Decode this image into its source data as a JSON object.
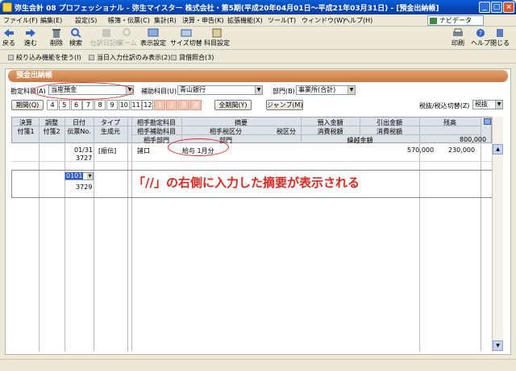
{
  "window": {
    "title": "弥生会計 08 プロフェッショナル - 弥生マイスター 株式会社・第5期(平成20年04月01日～平成21年03月31日) - [預金出納帳]",
    "minimize_label": "_",
    "maximize_label": "□",
    "close_label": "×"
  },
  "menubar": {
    "items": [
      "ファイル(F)",
      "編集(E)",
      "設定(S)",
      "帳簿・伝票(C)",
      "集計(R)",
      "決算・申告(K)",
      "拡張機能(X)",
      "ツール(T)",
      "ウィンドウ(W)",
      "ヘルプ(H)"
    ],
    "navi_label": "ナビデータ"
  },
  "toolbar": {
    "items": [
      "戻る",
      "進む",
      "削除",
      "検索",
      "仕訳日記帳",
      "ズーム",
      "表示設定",
      "サイズ切替",
      "科目設定"
    ],
    "right_items": [
      "印刷",
      "ヘルプ",
      "閉じる"
    ]
  },
  "optionbar": {
    "items": [
      "絞り込み機能を使う(I)",
      "当日入力仕訳のみ表示(2)",
      "貸借照合(3)"
    ]
  },
  "ledger": {
    "header": "預金出納帳",
    "account_label": "勘定科目(A)",
    "account_value": "当座預金",
    "sub_account_label": "補助科目(U)",
    "sub_account_value": "青山銀行",
    "dept_label": "部門(B)",
    "dept_value": "事業所(合計)",
    "period_button": "期間(Q)",
    "months": [
      "4",
      "5",
      "6",
      "7",
      "8",
      "9",
      "10",
      "11",
      "12",
      "1",
      "2",
      "3",
      "決"
    ],
    "all_period_button": "全期間(Y)",
    "jump_button": "ジャンプ(M)",
    "tax_label": "税抜/税込切替(Z)",
    "tax_value": "税抜"
  },
  "grid": {
    "headers": {
      "kessan": "決算",
      "fusen1": "付箋1",
      "chosei": "調整",
      "fusen2": "付箋2",
      "hizuke": "日付",
      "denpyo_no": "伝票No.",
      "type": "タイプ",
      "seiseimoto": "生成元",
      "aite_kamoku": "相手勘定科目",
      "aite_hojo": "相手補助科目",
      "aite_bumon": "相手部門",
      "tekiyo": "摘要",
      "zeiku": "税区分",
      "aite_zeiku": "相手税区分",
      "bumon": "部門",
      "azukeire": "預入金額",
      "shohizei1": "消費税額",
      "hikidashi": "引出金額",
      "shohizei2": "消費税額",
      "zandaka": "残高",
      "kurikoshi": "繰越金額",
      "kurikoshi_value": "800,000"
    },
    "rows": [
      {
        "date": "01/31",
        "voucher": "3727",
        "type": "[振伝]",
        "account": "諸口",
        "memo": "給与 1月分",
        "deposit": "570,000",
        "withdrawal": "230,000"
      },
      {
        "date": "0101",
        "voucher": "3729"
      }
    ]
  },
  "annotation": "「//」の右側に入力した摘要が表示される"
}
